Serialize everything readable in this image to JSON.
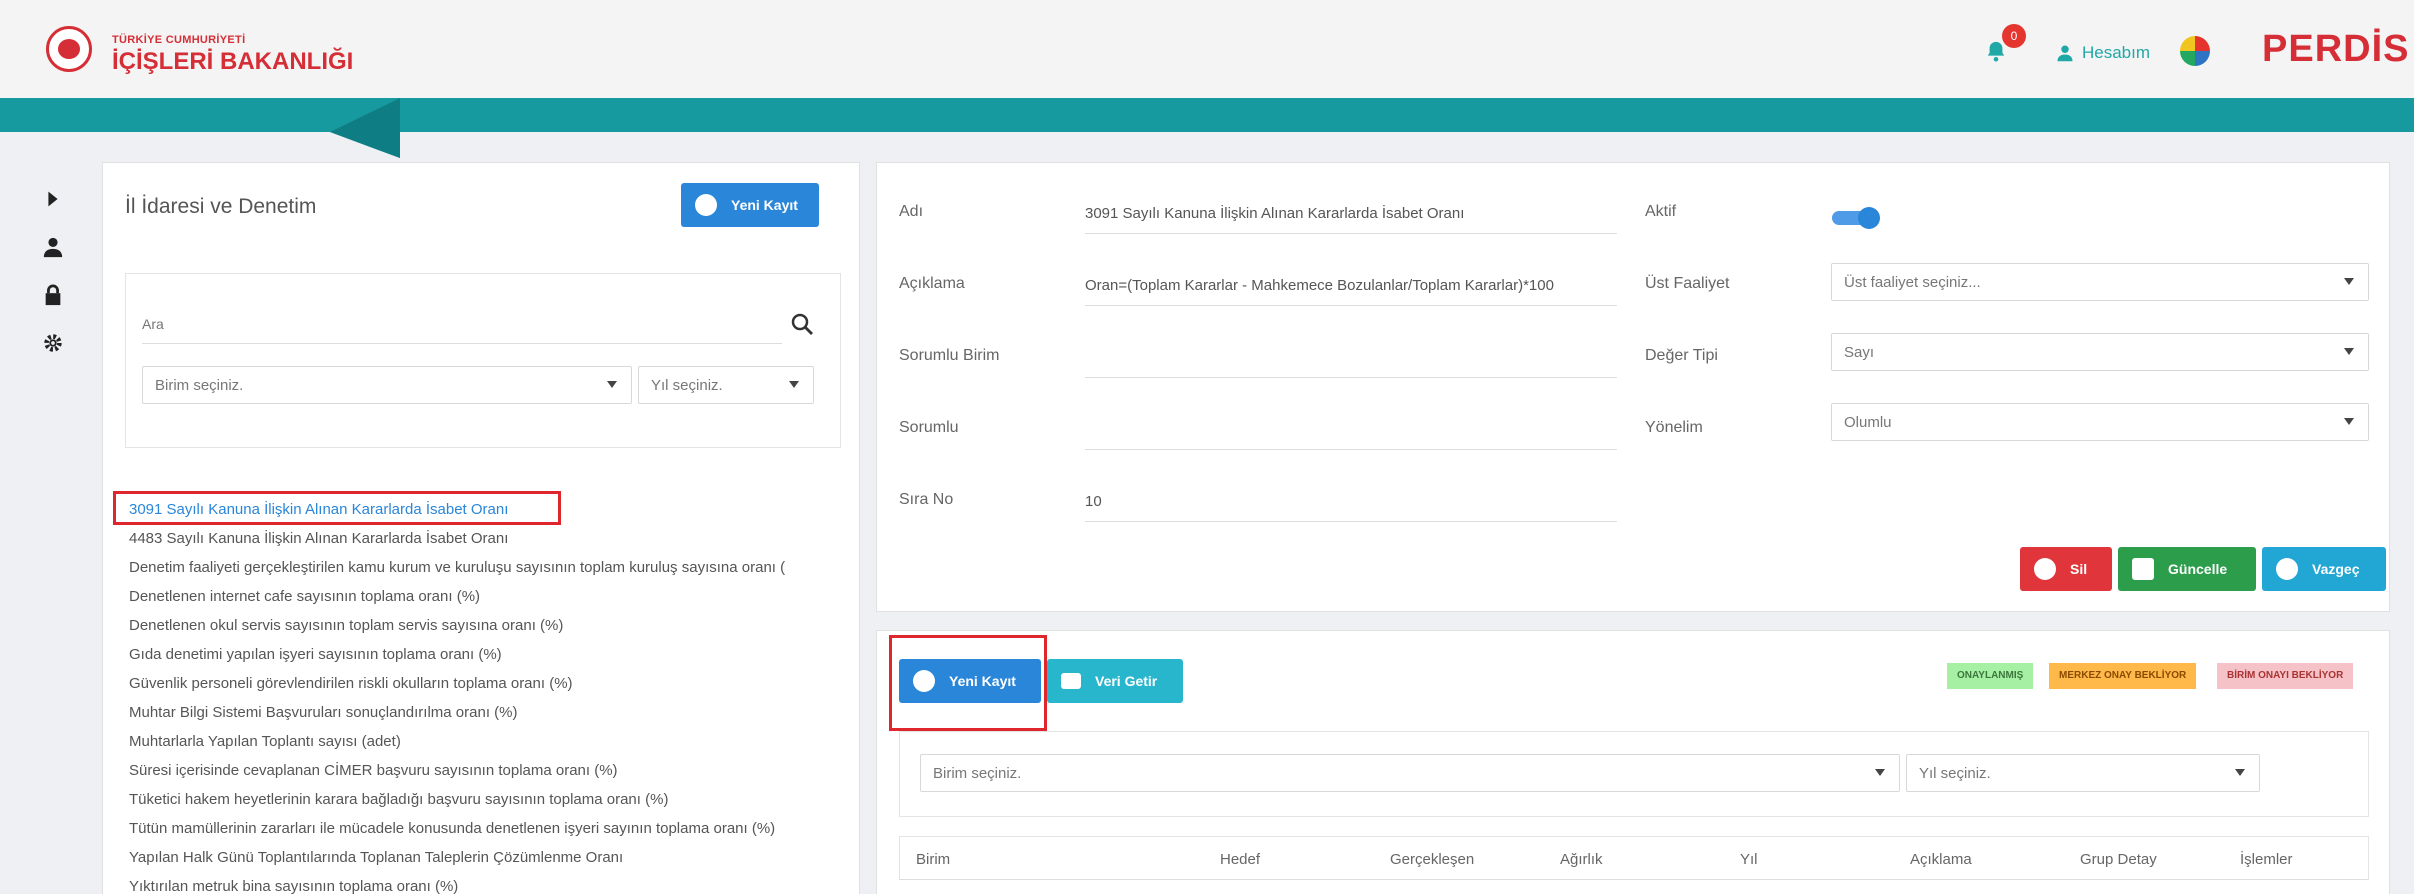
{
  "header": {
    "logo_top": "TÜRKİYE CUMHURİYETİ",
    "logo_main": "İÇİŞLERİ BAKANLIĞI",
    "notification_count": "0",
    "account_label": "Hesabım",
    "brand": "PERDİS"
  },
  "left_panel": {
    "title": "İl İdaresi ve Denetim",
    "new_button": "Yeni Kayıt",
    "search_placeholder": "Ara",
    "unit_select": "Birim seçiniz.",
    "year_select": "Yıl seçiniz.",
    "items": [
      "3091 Sayılı Kanuna İlişkin Alınan Kararlarda İsabet Oranı",
      "4483 Sayılı Kanuna İlişkin Alınan Kararlarda İsabet Oranı",
      "Denetim faaliyeti gerçekleştirilen kamu kurum ve kuruluşu sayısının toplam kuruluş sayısına oranı (",
      "Denetlenen internet cafe sayısının toplama oranı (%)",
      "Denetlenen okul servis sayısının toplam servis sayısına oranı (%)",
      "Gıda denetimi yapılan işyeri sayısının toplama oranı (%)",
      "Güvenlik personeli görevlendirilen riskli okulların toplama oranı (%)",
      "Muhtar Bilgi Sistemi Başvuruları sonuçlandırılma oranı (%)",
      "Muhtarlarla Yapılan Toplantı sayısı (adet)",
      "Süresi içerisinde cevaplanan CİMER başvuru sayısının toplama oranı (%)",
      "Tüketici hakem heyetlerinin karara bağladığı başvuru sayısının toplama oranı (%)",
      "Tütün mamüllerinin zararları ile mücadele konusunda denetlenen işyeri sayının toplama oranı (%)",
      "Yapılan Halk Günü Toplantılarında Toplanan Taleplerin Çözümlenme Oranı",
      "Yıktırılan metruk bina sayısının toplama oranı (%)"
    ]
  },
  "form": {
    "name_label": "Adı",
    "name_value": "3091 Sayılı Kanuna İlişkin Alınan Kararlarda İsabet Oranı",
    "desc_label": "Açıklama",
    "desc_value": "Oran=(Toplam Kararlar - Mahkemece Bozulanlar/Toplam Kararlar)*100",
    "unit_label": "Sorumlu Birim",
    "unit_value": "",
    "resp_label": "Sorumlu",
    "resp_value": "",
    "order_label": "Sıra No",
    "order_value": "10",
    "active_label": "Aktif",
    "active_on": true,
    "parent_label": "Üst Faaliyet",
    "parent_select": "Üst faaliyet seçiniz...",
    "type_label": "Değer Tipi",
    "type_select": "Sayı",
    "direction_label": "Yönelim",
    "direction_select": "Olumlu",
    "delete_button": "Sil",
    "update_button": "Güncelle",
    "cancel_button": "Vazgeç"
  },
  "data_panel": {
    "new_button": "Yeni Kayıt",
    "fetch_button": "Veri Getir",
    "status_approved": "ONAYLANMIŞ",
    "status_center": "MERKEZ ONAY BEKLİYOR",
    "status_unit": "BİRİM ONAYI BEKLİYOR",
    "unit_select": "Birim seçiniz.",
    "year_select": "Yıl seçiniz.",
    "columns": [
      "Birim",
      "Hedef",
      "Gerçekleşen",
      "Ağırlık",
      "Yıl",
      "Açıklama",
      "Grup Detay",
      "İşlemler"
    ]
  },
  "colors": {
    "brand_red": "#d62e36",
    "teal": "#169aa0",
    "primary_blue": "#2a86d9"
  }
}
